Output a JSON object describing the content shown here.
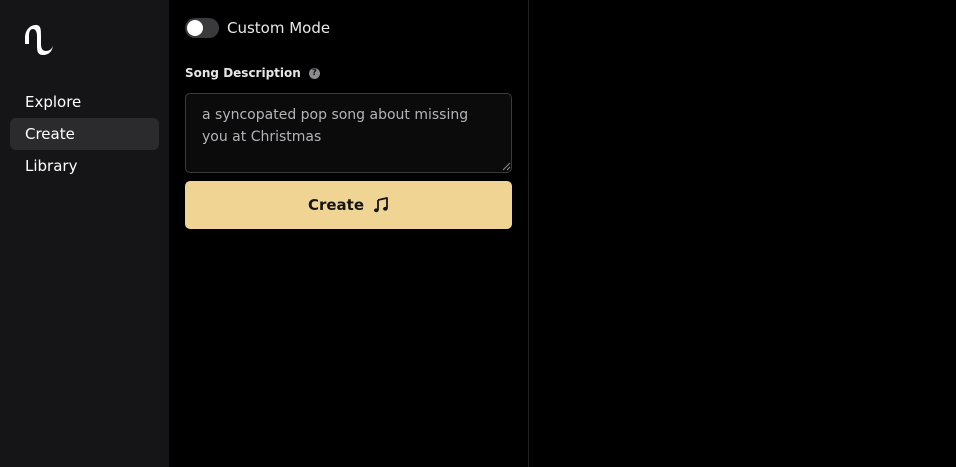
{
  "sidebar": {
    "logo_icon": "app-logo-wave-icon",
    "items": [
      {
        "label": "Explore",
        "active": false
      },
      {
        "label": "Create",
        "active": true
      },
      {
        "label": "Library",
        "active": false
      }
    ]
  },
  "form": {
    "custom_mode_label": "Custom Mode",
    "custom_mode_on": false,
    "description_label": "Song Description",
    "help_icon": "question-circle-icon",
    "description_value": "a syncopated pop song about missing you at Christmas",
    "create_label": "Create",
    "create_icon": "music-note-icon"
  },
  "colors": {
    "accent": "#f0d494",
    "sidebar_bg": "#151517",
    "active_item_bg": "#2b2b2e"
  }
}
